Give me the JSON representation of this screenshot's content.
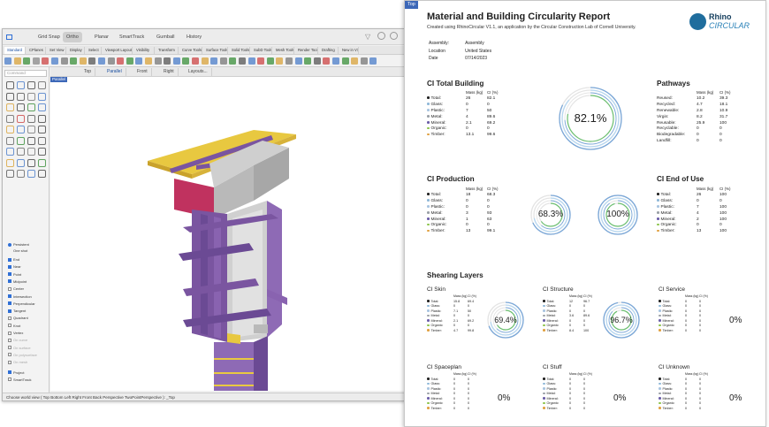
{
  "rhino": {
    "title_tabs": [
      "Grid Snap",
      "Ortho",
      "Planar",
      "SmartTrack",
      "Gumball",
      "History"
    ],
    "ribbon_tabs": [
      "Standard",
      "CPlanes",
      "Set View",
      "Display",
      "Select",
      "Viewport Layout",
      "Visibility",
      "Transform",
      "Curve Tools",
      "Surface Tools",
      "Solid Tools",
      "SubD Tools",
      "Mesh Tools",
      "Render Tools",
      "Drafting",
      "New in V7"
    ],
    "view_tabs": [
      "Top",
      "Parallel",
      "Front",
      "Right",
      "Layouts..."
    ],
    "command_placeholder": "Command",
    "viewport_label": "Parallel",
    "osnap": {
      "persistent": "Persistent",
      "one_shot": "One shot",
      "items": [
        {
          "label": "End",
          "on": true
        },
        {
          "label": "Near",
          "on": true
        },
        {
          "label": "Point",
          "on": true
        },
        {
          "label": "Midpoint",
          "on": true
        },
        {
          "label": "Center",
          "on": false
        },
        {
          "label": "Intersection",
          "on": true
        },
        {
          "label": "Perpendicular",
          "on": true
        },
        {
          "label": "Tangent",
          "on": true
        },
        {
          "label": "Quadrant",
          "on": false
        },
        {
          "label": "Knot",
          "on": false
        },
        {
          "label": "Vertex",
          "on": false
        },
        {
          "label": "On curve",
          "on": false,
          "dim": true
        },
        {
          "label": "On surface",
          "on": false,
          "dim": true
        },
        {
          "label": "On polysurface",
          "on": false,
          "dim": true
        },
        {
          "label": "On mesh",
          "on": false,
          "dim": true
        },
        {
          "label": "Project",
          "on": true
        },
        {
          "label": "SmartTrack",
          "on": false
        },
        {
          "label": "Disable all",
          "on": false
        }
      ]
    },
    "status": "Choose world view ( Top Bottom Left Right Front Back Perspective TwoPointPerspective ): _Top"
  },
  "report": {
    "tag": "Top",
    "title": "Material and Building Circularity Report",
    "subtitle": "Created using RhinoCircular V1.1, an application by the Circular Construction Lab of Cornell University.",
    "info": [
      [
        "Assembly:",
        "Assembly"
      ],
      [
        "Location",
        "United States"
      ],
      [
        "Date",
        "07/14/2023"
      ]
    ],
    "logo": {
      "line1": "Rhino",
      "line2": "CIRCULAR"
    },
    "colors": {
      "total": "#222222",
      "glass": "#8fb8d8",
      "plastic": "#a8c4e0",
      "metal": "#9aa0a6",
      "mineral": "#6b5ea8",
      "organic": "#8bc34a",
      "timber": "#e0a040",
      "ring_outer": "#7aa7d8",
      "ring_mid": "#b7d7f0",
      "ring_inner": "#6cc070"
    },
    "mass_header": "Mass (kg)",
    "ci_header": "CI (%)",
    "total_building": {
      "title": "CI Total Building",
      "percent": "82.1%",
      "ring": 0.821,
      "rows": [
        [
          "Total:",
          "26",
          "82.1"
        ],
        [
          "Glass:",
          "0",
          "0"
        ],
        [
          "Plastic:",
          "7",
          "50"
        ],
        [
          "Metal:",
          "4",
          "89.6"
        ],
        [
          "Mineral:",
          "2.1",
          "69.2"
        ],
        [
          "Organic:",
          "0",
          "0"
        ],
        [
          "Timber:",
          "13.1",
          "99.6"
        ]
      ]
    },
    "pathways": {
      "title": "Pathways",
      "rows": [
        [
          "Reused:",
          "10.2",
          "39.3"
        ],
        [
          "Recycled:",
          "4.7",
          "18.1"
        ],
        [
          "Renewable:",
          "2.8",
          "10.9"
        ],
        [
          "Virgin:",
          "8.2",
          "31.7"
        ],
        [
          "Reusable:",
          "25.9",
          "100"
        ],
        [
          "Recyclable:",
          "0",
          "0"
        ],
        [
          "Biodegradable:",
          "0",
          "0"
        ],
        [
          "Landfill:",
          "0",
          "0"
        ]
      ]
    },
    "production": {
      "title": "CI Production",
      "percent": "68.3%",
      "ring": 0.683,
      "rows": [
        [
          "Total:",
          "18",
          "68.3"
        ],
        [
          "Glass:",
          "0",
          "0"
        ],
        [
          "Plastic:",
          "0",
          "0"
        ],
        [
          "Metal:",
          "3",
          "93"
        ],
        [
          "Mineral:",
          "1",
          "63"
        ],
        [
          "Organic:",
          "0",
          "0"
        ],
        [
          "Timber:",
          "13",
          "99.1"
        ]
      ]
    },
    "end_of_use": {
      "title": "CI End of Use",
      "percent": "100%",
      "ring": 1.0,
      "rows": [
        [
          "Total:",
          "26",
          "100"
        ],
        [
          "Glass:",
          "0",
          "0"
        ],
        [
          "Plastic:",
          "7",
          "100"
        ],
        [
          "Metal:",
          "4",
          "100"
        ],
        [
          "Mineral:",
          "2",
          "100"
        ],
        [
          "Organic:",
          "0",
          "0"
        ],
        [
          "Timber:",
          "13",
          "100"
        ]
      ]
    },
    "shearing": {
      "title": "Shearing Layers",
      "skin": {
        "title": "CI Skin",
        "percent": "69.4%",
        "ring": 0.694,
        "rows": [
          [
            "Total:",
            "15.8",
            "69.4"
          ],
          [
            "Glass:",
            "0",
            "0"
          ],
          [
            "Plastic:",
            "7.1",
            "50"
          ],
          [
            "Metal:",
            "0",
            "0"
          ],
          [
            "Mineral:",
            "2.1",
            "69.2"
          ],
          [
            "Organic:",
            "0",
            "0"
          ],
          [
            "Timber:",
            "4.7",
            "99.8"
          ]
        ]
      },
      "structure": {
        "title": "CI Structure",
        "percent": "96.7%",
        "ring": 0.967,
        "rows": [
          [
            "Total:",
            "12",
            "96.7"
          ],
          [
            "Glass:",
            "0",
            "0"
          ],
          [
            "Plastic:",
            "0",
            "0"
          ],
          [
            "Metal:",
            "3.6",
            "89.6"
          ],
          [
            "Mineral:",
            "0",
            "0"
          ],
          [
            "Organic:",
            "0",
            "0"
          ],
          [
            "Timber:",
            "8.4",
            "100"
          ]
        ]
      },
      "service": {
        "title": "CI Service",
        "percent": "0%",
        "rows": [
          [
            "Total:",
            "0",
            "0"
          ],
          [
            "Glass:",
            "0",
            "0"
          ],
          [
            "Plastic:",
            "0",
            "0"
          ],
          [
            "Metal:",
            "0",
            "0"
          ],
          [
            "Mineral:",
            "0",
            "0"
          ],
          [
            "Organic:",
            "0",
            "0"
          ],
          [
            "Timber:",
            "0",
            "0"
          ]
        ]
      },
      "spaceplan": {
        "title": "CI Spaceplan",
        "percent": "0%",
        "rows": [
          [
            "Total:",
            "0",
            "0"
          ],
          [
            "Glass:",
            "0",
            "0"
          ],
          [
            "Plastic:",
            "0",
            "0"
          ],
          [
            "Metal:",
            "0",
            "0"
          ],
          [
            "Mineral:",
            "0",
            "0"
          ],
          [
            "Organic:",
            "0",
            "0"
          ],
          [
            "Timber:",
            "0",
            "0"
          ]
        ]
      },
      "stuff": {
        "title": "CI Stuff",
        "percent": "0%",
        "rows": [
          [
            "Total:",
            "0",
            "0"
          ],
          [
            "Glass:",
            "0",
            "0"
          ],
          [
            "Plastic:",
            "0",
            "0"
          ],
          [
            "Metal:",
            "0",
            "0"
          ],
          [
            "Mineral:",
            "0",
            "0"
          ],
          [
            "Organic:",
            "0",
            "0"
          ],
          [
            "Timber:",
            "0",
            "0"
          ]
        ]
      },
      "unknown": {
        "title": "CI Unknown",
        "percent": "0%",
        "rows": [
          [
            "Total:",
            "0",
            "0"
          ],
          [
            "Glass:",
            "0",
            "0"
          ],
          [
            "Plastic:",
            "0",
            "0"
          ],
          [
            "Metal:",
            "0",
            "0"
          ],
          [
            "Mineral:",
            "0",
            "0"
          ],
          [
            "Organic:",
            "0",
            "0"
          ],
          [
            "Timber:",
            "0",
            "0"
          ]
        ]
      }
    }
  }
}
